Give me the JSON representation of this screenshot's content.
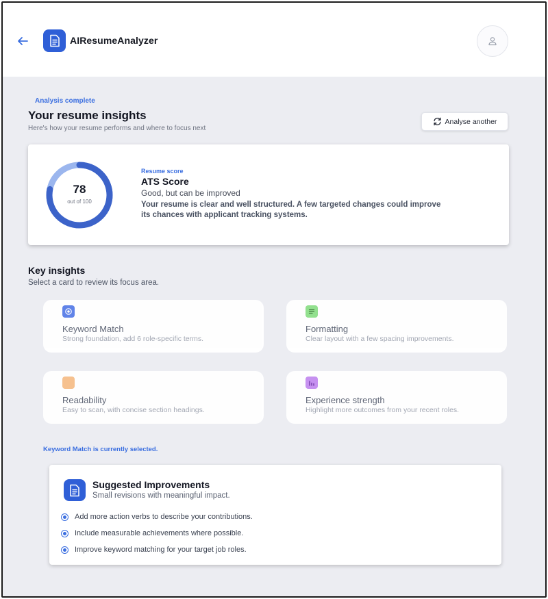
{
  "header": {
    "app_title": "AIResumeAnalyzer",
    "icons": {
      "back": "arrow-left-icon",
      "logo": "document-icon",
      "avatar": "user-icon"
    }
  },
  "summary": {
    "status": "Analysis complete",
    "title": "Your resume insights",
    "subtitle": "Here's how your resume performs and where to focus next",
    "analyse_button": "Analyse another"
  },
  "score": {
    "value": "78",
    "out_of": "out of 100",
    "progress": 0.78,
    "kicker": "Resume score",
    "title": "ATS Score",
    "verdict": "Good, but can be improved",
    "description": "Your resume is clear and well structured. A few targeted changes could improve its chances with applicant tracking systems."
  },
  "insights": {
    "title": "Key insights",
    "subtitle": "Select a card to review its focus area.",
    "cards": [
      {
        "title": "Keyword Match",
        "description": "Strong foundation, add 6 role-specific terms.",
        "icon": "target-icon",
        "color": "#5b7fe8"
      },
      {
        "title": "Formatting",
        "description": "Clear layout with a few spacing improvements.",
        "icon": "layout-icon",
        "color": "#8fe08a"
      },
      {
        "title": "Readability",
        "description": "Easy to scan, with concise section headings.",
        "icon": "book-icon",
        "color": "#f7c08c"
      },
      {
        "title": "Experience strength",
        "description": "Highlight more outcomes from your recent roles.",
        "icon": "bar-chart-icon",
        "color": "#c58ef0"
      }
    ],
    "selected_note": "Keyword Match is currently selected."
  },
  "improvements": {
    "title": "Suggested Improvements",
    "subtitle": "Small revisions with meaningful impact.",
    "items": [
      "Add more action verbs to describe your contributions.",
      "Include measurable achievements where possible.",
      "Improve keyword matching for your target job roles."
    ]
  },
  "colors": {
    "accent": "#2f5fd7",
    "link": "#3a6ee0",
    "ring_track": "#9bb6ee",
    "ring_fill": "#3c63c9",
    "background": "#ecedf2"
  }
}
